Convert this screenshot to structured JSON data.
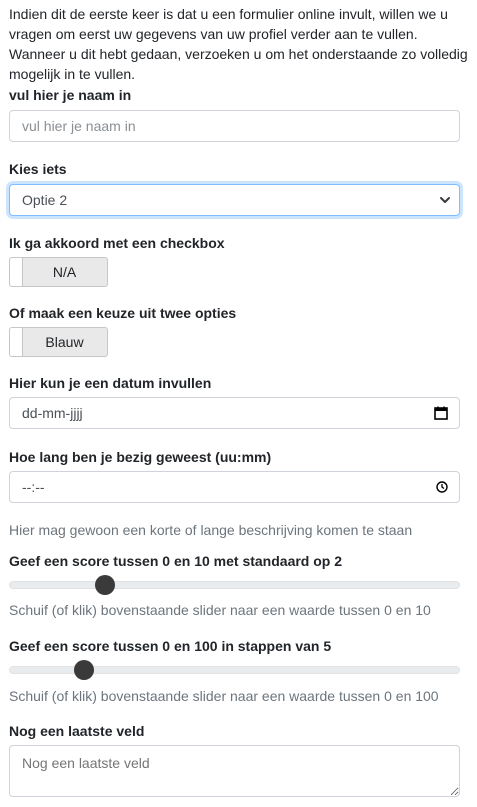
{
  "intro": {
    "text_before": "Indien dit de eerste keer is dat u een formulier online invult, willen we u vragen om eerst uw gegevens van uw ",
    "link": "profiel",
    "text_after": " verder aan te vullen. Wanneer u dit hebt gedaan, verzoeken u om het onderstaande zo volledig mogelijk in te vullen."
  },
  "name": {
    "label": "vul hier je naam in",
    "placeholder": "vul hier je naam in"
  },
  "choice": {
    "label": "Kies iets",
    "selected": "Optie 2"
  },
  "checkbox": {
    "label": "Ik ga akkoord met een checkbox",
    "value": "N/A"
  },
  "twoOptions": {
    "label": "Of maak een keuze uit twee opties",
    "value": "Blauw"
  },
  "date": {
    "label": "Hier kun je een datum invullen",
    "placeholder": "dd-mm-jjjj",
    "icon": "calendar-icon"
  },
  "duration": {
    "label": "Hoe lang ben je bezig geweest (uu:mm)",
    "placeholder": "--:--",
    "icon": "clock-icon"
  },
  "description": {
    "text": "Hier mag gewoon een korte of lange beschrijving komen te staan"
  },
  "score10": {
    "label": "Geef een score tussen 0 en 10 met standaard op 2",
    "value": 2,
    "min": 0,
    "max": 10,
    "help": "Schuif (of klik) bovenstaande slider naar een waarde tussen 0 en 10"
  },
  "score100": {
    "label": "Geef een score tussen 0 en 100 in stappen van 5",
    "value": 15,
    "min": 0,
    "max": 100,
    "step": 5,
    "help": "Schuif (of klik) bovenstaande slider naar een waarde tussen 0 en 100"
  },
  "lastField": {
    "label": "Nog een laatste veld",
    "placeholder": "Nog een laatste veld"
  }
}
